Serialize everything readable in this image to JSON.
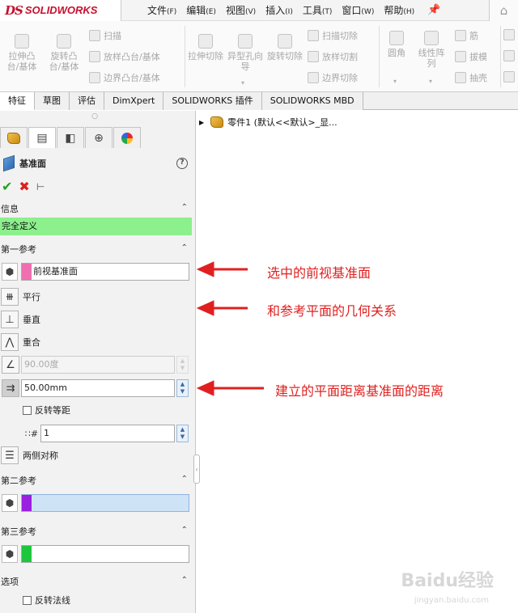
{
  "app": {
    "logo_mark": "DS",
    "logo_text": "SOLIDWORKS"
  },
  "menu": [
    {
      "label": "文件",
      "key": "(F)"
    },
    {
      "label": "编辑",
      "key": "(E)"
    },
    {
      "label": "视图",
      "key": "(V)"
    },
    {
      "label": "插入",
      "key": "(I)"
    },
    {
      "label": "工具",
      "key": "(T)"
    },
    {
      "label": "窗口",
      "key": "(W)"
    },
    {
      "label": "帮助",
      "key": "(H)"
    }
  ],
  "ribbon": {
    "extrude_boss": "拉伸凸台/基体",
    "revolve_boss": "旋转凸台/基体",
    "sweep": "扫描",
    "loft_boss": "放样凸台/基体",
    "boundary_boss": "边界凸台/基体",
    "extrude_cut": "拉伸切除",
    "hole_wizard": "异型孔向导",
    "revolve_cut": "旋转切除",
    "swept_cut": "扫描切除",
    "lofted_cut": "放样切割",
    "boundary_cut": "边界切除",
    "fillet": "圆角",
    "linear_pattern": "线性阵列",
    "rib": "筋",
    "draft": "拔模",
    "shell": "抽壳"
  },
  "cm_tabs": [
    "特征",
    "草图",
    "评估",
    "DimXpert",
    "SOLIDWORKS 插件",
    "SOLIDWORKS MBD"
  ],
  "panel": {
    "title": "基准面",
    "help": "?",
    "info_header": "信息",
    "status": "完全定义",
    "first_ref_header": "第一参考",
    "first_ref_value": "前视基准面",
    "parallel": "平行",
    "perpendicular": "垂直",
    "coincident": "重合",
    "angle_value": "90.00度",
    "distance_value": "50.00mm",
    "flip_offset": "反转等距",
    "instances": "1",
    "mid_plane": "两侧对称",
    "second_ref_header": "第二参考",
    "third_ref_header": "第三参考",
    "options_header": "选项",
    "flip_normal": "反转法线"
  },
  "tree": {
    "root_label": "零件1 (默认<<默认>_显..."
  },
  "annotations": {
    "selected_plane": "选中的前视基准面",
    "geometric_relation": "和参考平面的几何关系",
    "distance_note": "建立的平面距离基准面的距离"
  },
  "colors": {
    "first_ref_swatch": "#f06fb0",
    "second_ref_swatch": "#9a1fe0",
    "third_ref_swatch": "#1ec63d",
    "status_bar": "#8cf08c",
    "annotation": "#e02020",
    "brand": "#c8102e"
  },
  "watermark": {
    "main": "Baidu经验",
    "sub": "jingyan.baidu.com"
  }
}
